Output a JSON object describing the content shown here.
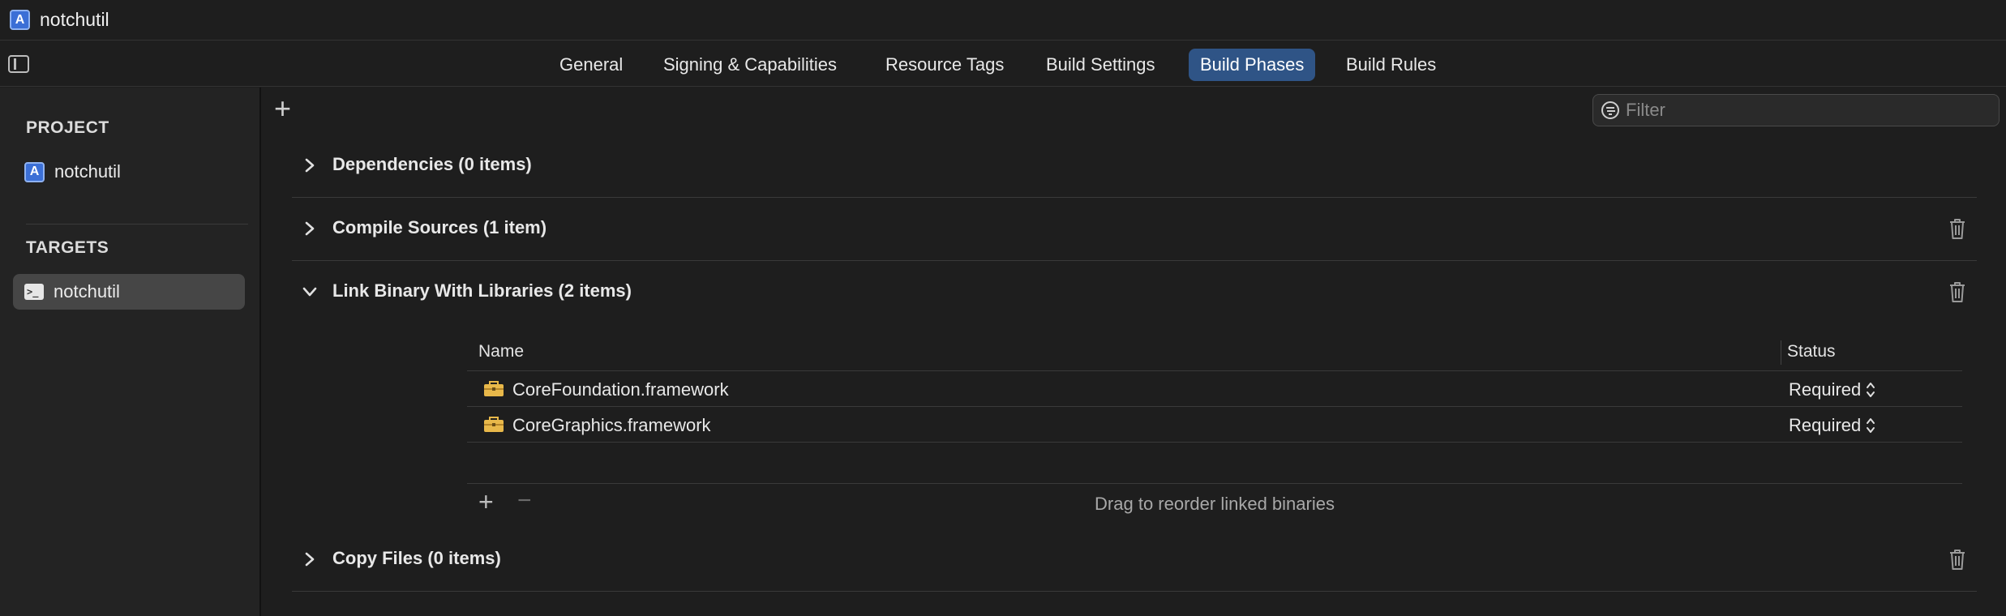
{
  "window": {
    "title": "notchutil"
  },
  "tabs": [
    {
      "label": "General",
      "active": false
    },
    {
      "label": "Signing & Capabilities",
      "active": false
    },
    {
      "label": "Resource Tags",
      "active": false
    },
    {
      "label": "Build Settings",
      "active": false
    },
    {
      "label": "Build Phases",
      "active": true
    },
    {
      "label": "Build Rules",
      "active": false
    }
  ],
  "sidebar": {
    "project_heading": "PROJECT",
    "project_item": "notchutil",
    "targets_heading": "TARGETS",
    "target_item": "notchutil"
  },
  "toolbar": {
    "filter_placeholder": "Filter"
  },
  "phases": [
    {
      "title": "Dependencies (0 items)",
      "expanded": false
    },
    {
      "title": "Compile Sources (1 item)",
      "expanded": false
    },
    {
      "title": "Link Binary With Libraries (2 items)",
      "expanded": true
    },
    {
      "title": "Copy Files (0 items)",
      "expanded": false
    }
  ],
  "libraries": {
    "columns": {
      "name": "Name",
      "status": "Status"
    },
    "rows": [
      {
        "name": "CoreFoundation.framework",
        "status": "Required"
      },
      {
        "name": "CoreGraphics.framework",
        "status": "Required"
      }
    ],
    "add_symbol": "+",
    "remove_symbol": "−",
    "hint": "Drag to reorder linked binaries"
  },
  "colors": {
    "accent_tab": "#2f5486",
    "background": "#1e1e1e",
    "sidebar_bg": "#232323",
    "framework_icon": "#e8b84a"
  },
  "icons": [
    "app-project-icon",
    "sidebar-toggle-icon",
    "terminal-icon",
    "plus-icon",
    "filter-icon",
    "chevron-right-icon",
    "chevron-down-icon",
    "trash-icon",
    "toolbox-icon",
    "up-down-icon"
  ]
}
